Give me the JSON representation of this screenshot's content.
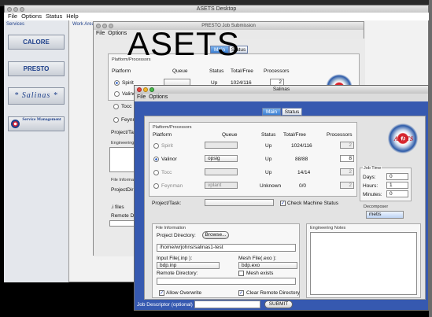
{
  "desktop": {
    "title": "ASETS Desktop"
  },
  "menubar": [
    "File",
    "Options",
    "Status",
    "Help"
  ],
  "sidebar": {
    "header": "Services",
    "items": [
      "CALORE",
      "PRESTO",
      "* Salinas *",
      "Service Management"
    ]
  },
  "workarea_label": "Work Area",
  "overlay_title": "ASETS",
  "presto": {
    "title": "PRESTO Job Submission",
    "menu": [
      "File",
      "Options"
    ],
    "tabs": [
      "Main",
      "Status"
    ],
    "group": "Platform/Processors",
    "headers": [
      "Platform",
      "Queue",
      "Status",
      "Total/Free",
      "Processors"
    ],
    "rows": [
      "Spirit",
      "Valinor",
      "Tocc",
      "Feynm"
    ],
    "row1": {
      "status": "Up",
      "totalfree": "1024/116",
      "proc": "2"
    },
    "project_lbl": "Project/Task",
    "engineering_lbl": "Engineering N",
    "file_info": "File Informati",
    "project_dir": "ProjectDir",
    "files_lbl": ".i files",
    "remote_dir": "Remote Di"
  },
  "salinas": {
    "title": "Salinas",
    "menu": [
      "File",
      "Options"
    ],
    "tabs": [
      "Main",
      "Status"
    ],
    "group": "Platform/Processors",
    "headers": {
      "platform": "Platform",
      "queue": "Queue",
      "status": "Status",
      "totalfree": "Total/Free",
      "processors": "Processors"
    },
    "rows": [
      {
        "name": "Spirit",
        "queue": "",
        "status": "Up",
        "totalfree": "1024/116",
        "proc": "2"
      },
      {
        "name": "Valinor",
        "queue": "opsig",
        "status": "Up",
        "totalfree": "88/88",
        "proc": "8"
      },
      {
        "name": "Tocc",
        "queue": "",
        "status": "Up",
        "totalfree": "14/14",
        "proc": "2"
      },
      {
        "name": "Feynman",
        "queue": "vplant",
        "status": "Unknown",
        "totalfree": "0/0",
        "proc": "2"
      }
    ],
    "project_task": "Project/Task:",
    "check_machine": "Check Machine Status",
    "job_time": {
      "label": "Job Time",
      "days_lbl": "Days:",
      "days": "0",
      "hours_lbl": "Hours:",
      "hours": "1",
      "minutes_lbl": "Minutes:",
      "minutes": "0"
    },
    "decomposer": {
      "label": "Decomposer",
      "value": "metis"
    },
    "file_info": {
      "label": "File Information",
      "project_dir_lbl": "Project Directory:",
      "browse": "Browse...",
      "project_dir": "/home/wrjohns/salinas1-test",
      "input_lbl": "Input File(.inp ):",
      "input": "bdp.inp",
      "mesh_lbl": "Mesh File(.exo ):",
      "mesh": "bdp.exo",
      "remote_lbl": "Remote Directory:",
      "mesh_exists": "Mesh exists",
      "allow_overwrite": "Allow Overwrite",
      "clear_remote": "Clear Remote Directory"
    },
    "engineering_notes": "Engineering Notes",
    "job_descriptor": "Job Descriptor (optional)",
    "submit": "SUBMIT",
    "logo_text": "ASETS"
  },
  "colors": {
    "blue_panel": "#3659b0",
    "accent": "#2a5fc8"
  }
}
